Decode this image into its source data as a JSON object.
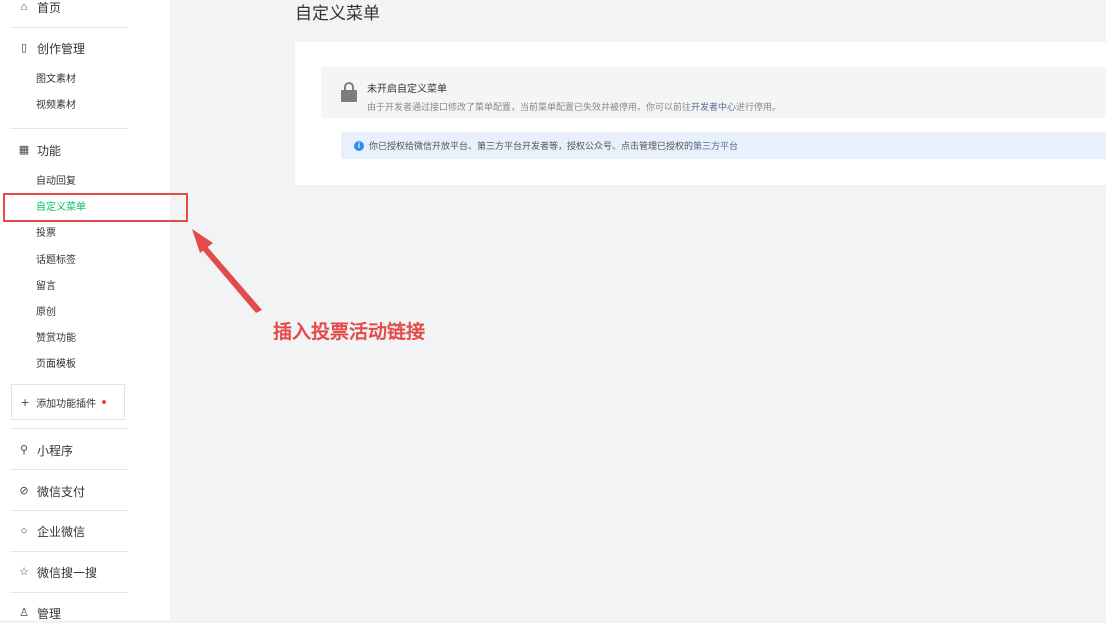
{
  "sidebar": {
    "home": {
      "label": "首页",
      "icon": "home-icon"
    },
    "content": {
      "label": "创作管理",
      "icon": "document-icon",
      "items": [
        "图文素材",
        "视频素材"
      ]
    },
    "features": {
      "label": "功能",
      "icon": "grid-icon",
      "items": [
        "自动回复",
        "自定义菜单",
        "投票",
        "话题标签",
        "留言",
        "原创",
        "赞赏功能",
        "页面模板"
      ],
      "active_index": 1
    },
    "add_plugin": {
      "label": "添加功能插件"
    },
    "groups": [
      {
        "label": "小程序",
        "icon": "link-icon"
      },
      {
        "label": "微信支付",
        "icon": "pay-icon"
      },
      {
        "label": "企业微信",
        "icon": "chat-icon"
      },
      {
        "label": "微信搜一搜",
        "icon": "star-icon"
      },
      {
        "label": "管理",
        "icon": "user-icon"
      }
    ]
  },
  "main": {
    "title": "自定义菜单",
    "lock_notice": {
      "title": "未开启自定义菜单",
      "desc": "由于开发者通过接口修改了菜单配置，当前菜单配置已失效并被停用。你可以前往",
      "link": "开发者中心",
      "desc_suffix": "进行停用。"
    },
    "info_notice": {
      "text": "你已授权给微信开放平台、第三方平台开发者等，授权公众号、点击管理已授权的",
      "link": "第三方平台"
    }
  },
  "annotation": {
    "text": "插入投票活动链接",
    "color": "#e34b4b"
  },
  "colors": {
    "accent": "#07c160",
    "link": "#576b95",
    "info": "#2d8cf0"
  }
}
